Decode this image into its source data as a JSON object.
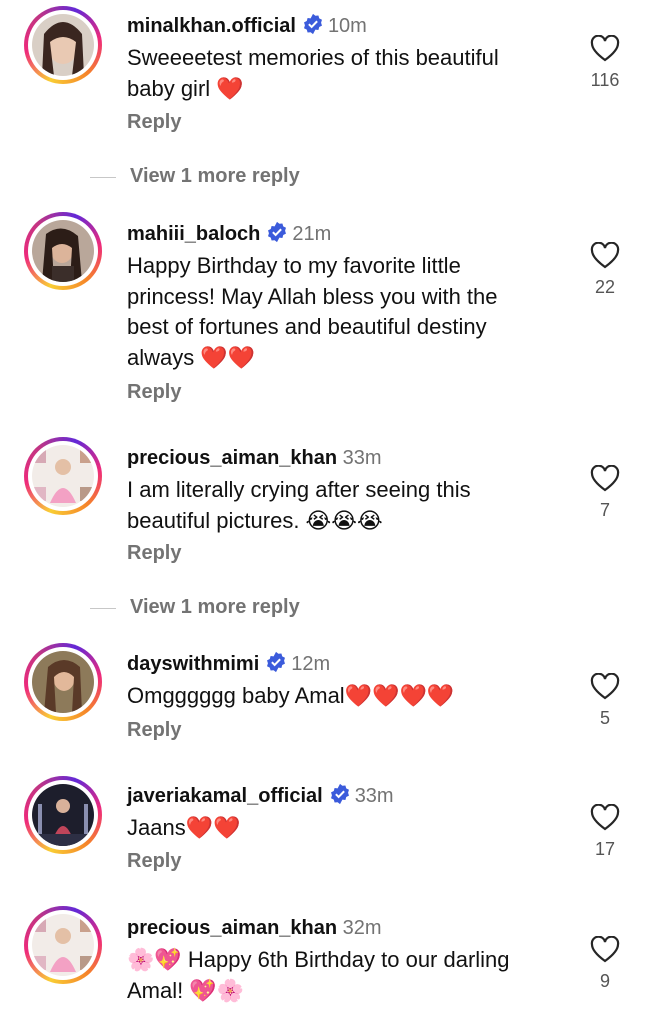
{
  "comments": [
    {
      "username": "minalkhan.official",
      "verified": true,
      "time": "10m",
      "text": "Sweeeetest memories of this beautiful baby girl ❤️",
      "reply": "Reply",
      "likes": "116"
    },
    {
      "username": "mahiii_baloch",
      "verified": true,
      "time": "21m",
      "text": "Happy Birthday to my favorite little princess! May Allah bless you with the best of fortunes and beautiful destiny always ❤️❤️",
      "reply": "Reply",
      "likes": "22"
    },
    {
      "username": "precious_aiman_khan",
      "verified": false,
      "time": "33m",
      "text": "I am literally crying after seeing this beautiful pictures. 😭😭😭",
      "reply": "Reply",
      "likes": "7"
    },
    {
      "username": "dayswithmimi",
      "verified": true,
      "time": "12m",
      "text": "Omgggggg baby Amal❤️❤️❤️❤️",
      "reply": "Reply",
      "likes": "5"
    },
    {
      "username": "javeriakamal_official",
      "verified": true,
      "time": "33m",
      "text": "Jaans❤️❤️",
      "reply": "Reply",
      "likes": "17"
    },
    {
      "username": "precious_aiman_khan",
      "verified": false,
      "time": "32m",
      "text": "🌸💖 Happy 6th Birthday to our darling Amal! 💖🌸",
      "reply": "",
      "likes": "9"
    }
  ],
  "view_more": [
    "View 1 more reply",
    "View 1 more reply"
  ],
  "colors": {
    "verified": "#3b5bdb",
    "heart": "#e0245e",
    "secondary": "#737373"
  },
  "icons": {
    "like": "heart-outline-icon",
    "verified": "verified-badge-icon"
  }
}
